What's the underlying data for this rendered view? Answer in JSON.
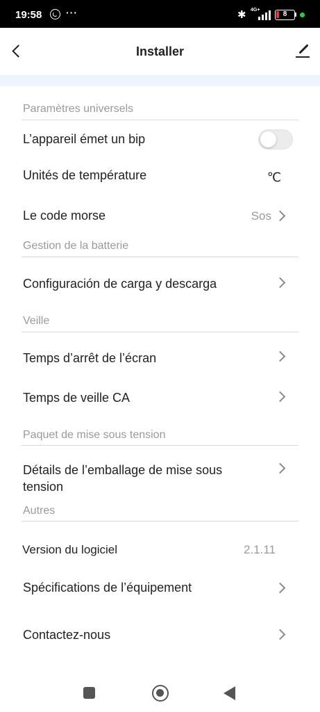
{
  "status_bar": {
    "time": "19:58",
    "dots": "···",
    "network": "4G+",
    "battery_level": "8"
  },
  "header": {
    "title": "Installer"
  },
  "sections": {
    "universal": {
      "title": "Paramètres universels",
      "beep_label": "L’appareil émet un bip",
      "beep_on": false,
      "temp_label": "Unités de température",
      "temp_value": "℃",
      "morse_label": "Le code morse",
      "morse_value": "Sos"
    },
    "battery": {
      "title": "Gestion de la batterie",
      "charge_label": "Configuración de carga y descarga"
    },
    "standby": {
      "title": "Veille",
      "screen_off_label": "Temps d’arrêt de l’écran",
      "ac_standby_label": "Temps de veille CA"
    },
    "power_pack": {
      "title": "Paquet de mise sous tension",
      "details_line1": "Détails de l’emballage de mise sous",
      "details_line2": "tension"
    },
    "others": {
      "title": "Autres",
      "version_label": "Version du logiciel",
      "version_value": "2.1.11",
      "specs_label": "Spécifications de l’équipement",
      "contact_label": "Contactez-nous"
    }
  },
  "colors": {
    "accent_band": "#eef4fb",
    "battery_low": "#e53935",
    "status_dot": "#2ecc40"
  }
}
